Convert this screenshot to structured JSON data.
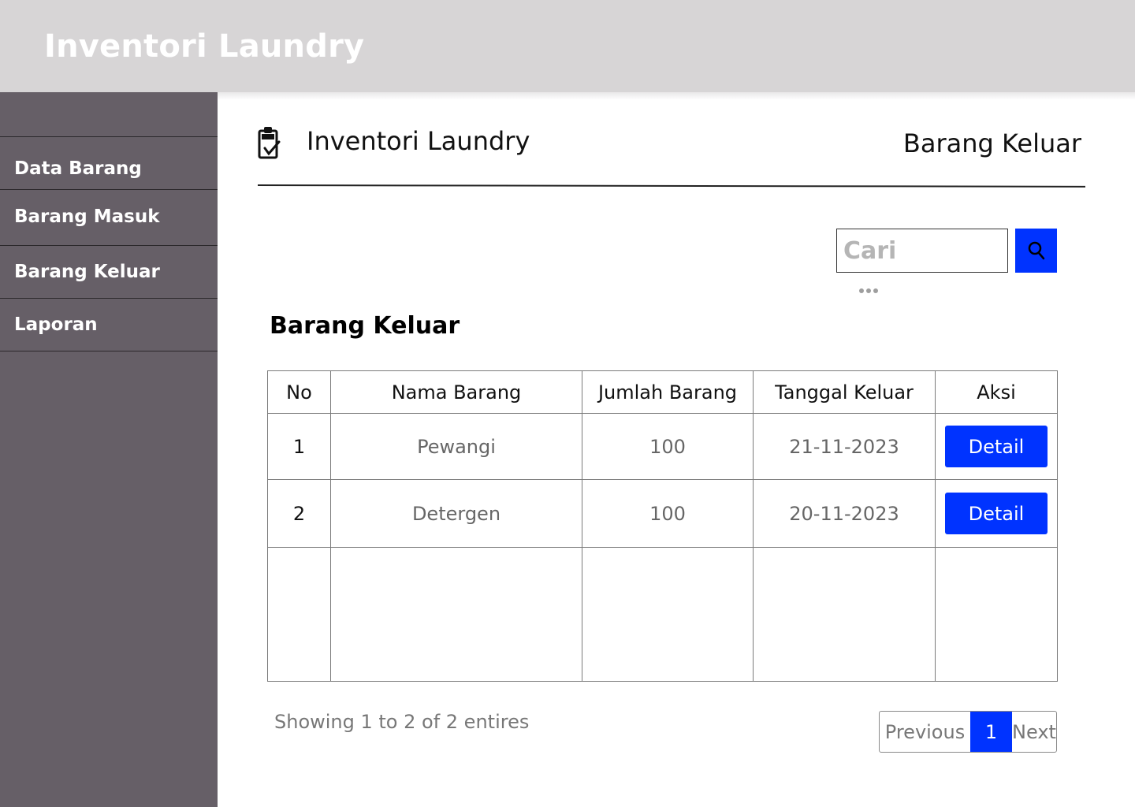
{
  "app": {
    "title": "Inventori Laundry"
  },
  "sidebar": {
    "items": [
      {
        "label": "Data Barang"
      },
      {
        "label": "Barang Masuk"
      },
      {
        "label": "Barang Keluar"
      },
      {
        "label": "Laporan"
      }
    ]
  },
  "header": {
    "brand_icon": "clipboard-check-icon",
    "brand_name": "Inventori Laundry",
    "page_heading": "Barang Keluar"
  },
  "search": {
    "placeholder": "Cari",
    "button_icon": "search-icon"
  },
  "section": {
    "title": "Barang Keluar"
  },
  "table": {
    "headers": [
      "No",
      "Nama Barang",
      "Jumlah Barang",
      "Tanggal Keluar",
      "Aksi"
    ],
    "rows": [
      {
        "no": "1",
        "nama": "Pewangi",
        "jumlah": "100",
        "tanggal": "21-11-2023",
        "aksi": "Detail"
      },
      {
        "no": "2",
        "nama": "Detergen",
        "jumlah": "100",
        "tanggal": "20-11-2023",
        "aksi": "Detail"
      }
    ]
  },
  "footer": {
    "showing": "Showing 1 to 2 of 2 entires",
    "pagination": {
      "previous": "Previous",
      "current": "1",
      "next": "Next"
    }
  },
  "colors": {
    "accent": "#0033ff",
    "sidebar": "#665f67",
    "topbar": "#d7d5d6"
  }
}
